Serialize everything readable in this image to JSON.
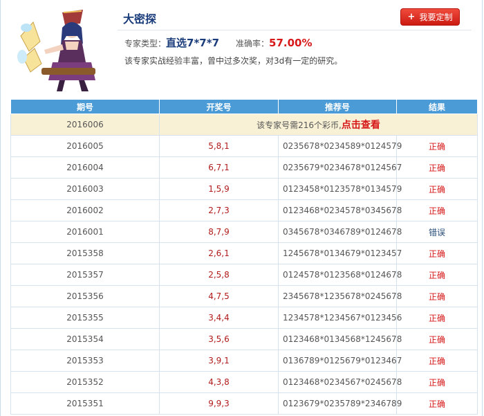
{
  "header": {
    "title": "大密探",
    "custom_button": "我要定制",
    "type_label": "专家类型：",
    "type_value": "直选7*7*7",
    "rate_label": "准确率：",
    "rate_value": "57.00%",
    "description": "该专家实战经验丰富，曾中过多次奖，对3d有一定的研究。"
  },
  "table": {
    "columns": [
      "期号",
      "开奖号",
      "推荐号",
      "结果"
    ],
    "notice": {
      "period": "2016006",
      "text": "该专家号需216个彩币,",
      "link": "点击查看"
    },
    "rows": [
      {
        "period": "2016005",
        "open": "5,8,1",
        "rec": "0235678*0234589*0124579",
        "result": "正确"
      },
      {
        "period": "2016004",
        "open": "6,7,1",
        "rec": "0235679*0234678*0124567",
        "result": "正确"
      },
      {
        "period": "2016003",
        "open": "1,5,9",
        "rec": "0123458*0123578*0134579",
        "result": "正确"
      },
      {
        "period": "2016002",
        "open": "2,7,3",
        "rec": "0123468*0234578*0345678",
        "result": "正确"
      },
      {
        "period": "2016001",
        "open": "8,7,9",
        "rec": "0345678*0346789*0124678",
        "result": "错误"
      },
      {
        "period": "2015358",
        "open": "2,6,1",
        "rec": "1245678*0134679*0123457",
        "result": "正确"
      },
      {
        "period": "2015357",
        "open": "2,5,8",
        "rec": "0124578*0123568*0124678",
        "result": "正确"
      },
      {
        "period": "2015356",
        "open": "4,7,5",
        "rec": "2345678*1235678*0245678",
        "result": "正确"
      },
      {
        "period": "2015355",
        "open": "3,4,4",
        "rec": "1234578*1234567*0123456",
        "result": "正确"
      },
      {
        "period": "2015354",
        "open": "3,5,6",
        "rec": "0123468*0134568*1245678",
        "result": "正确"
      },
      {
        "period": "2015353",
        "open": "3,9,1",
        "rec": "0136789*0125679*0123467",
        "result": "正确"
      },
      {
        "period": "2015352",
        "open": "4,3,8",
        "rec": "0123468*0234567*0245678",
        "result": "正确"
      },
      {
        "period": "2015351",
        "open": "9,9,3",
        "rec": "0123679*0235789*2346789",
        "result": "正确"
      }
    ]
  },
  "colors": {
    "header_blue": "#4a9bd6",
    "accent_red": "#d61818",
    "title_blue": "#1a3c7a"
  },
  "icons": {
    "avatar": "character-avatar-image",
    "plus": "plus-icon"
  }
}
